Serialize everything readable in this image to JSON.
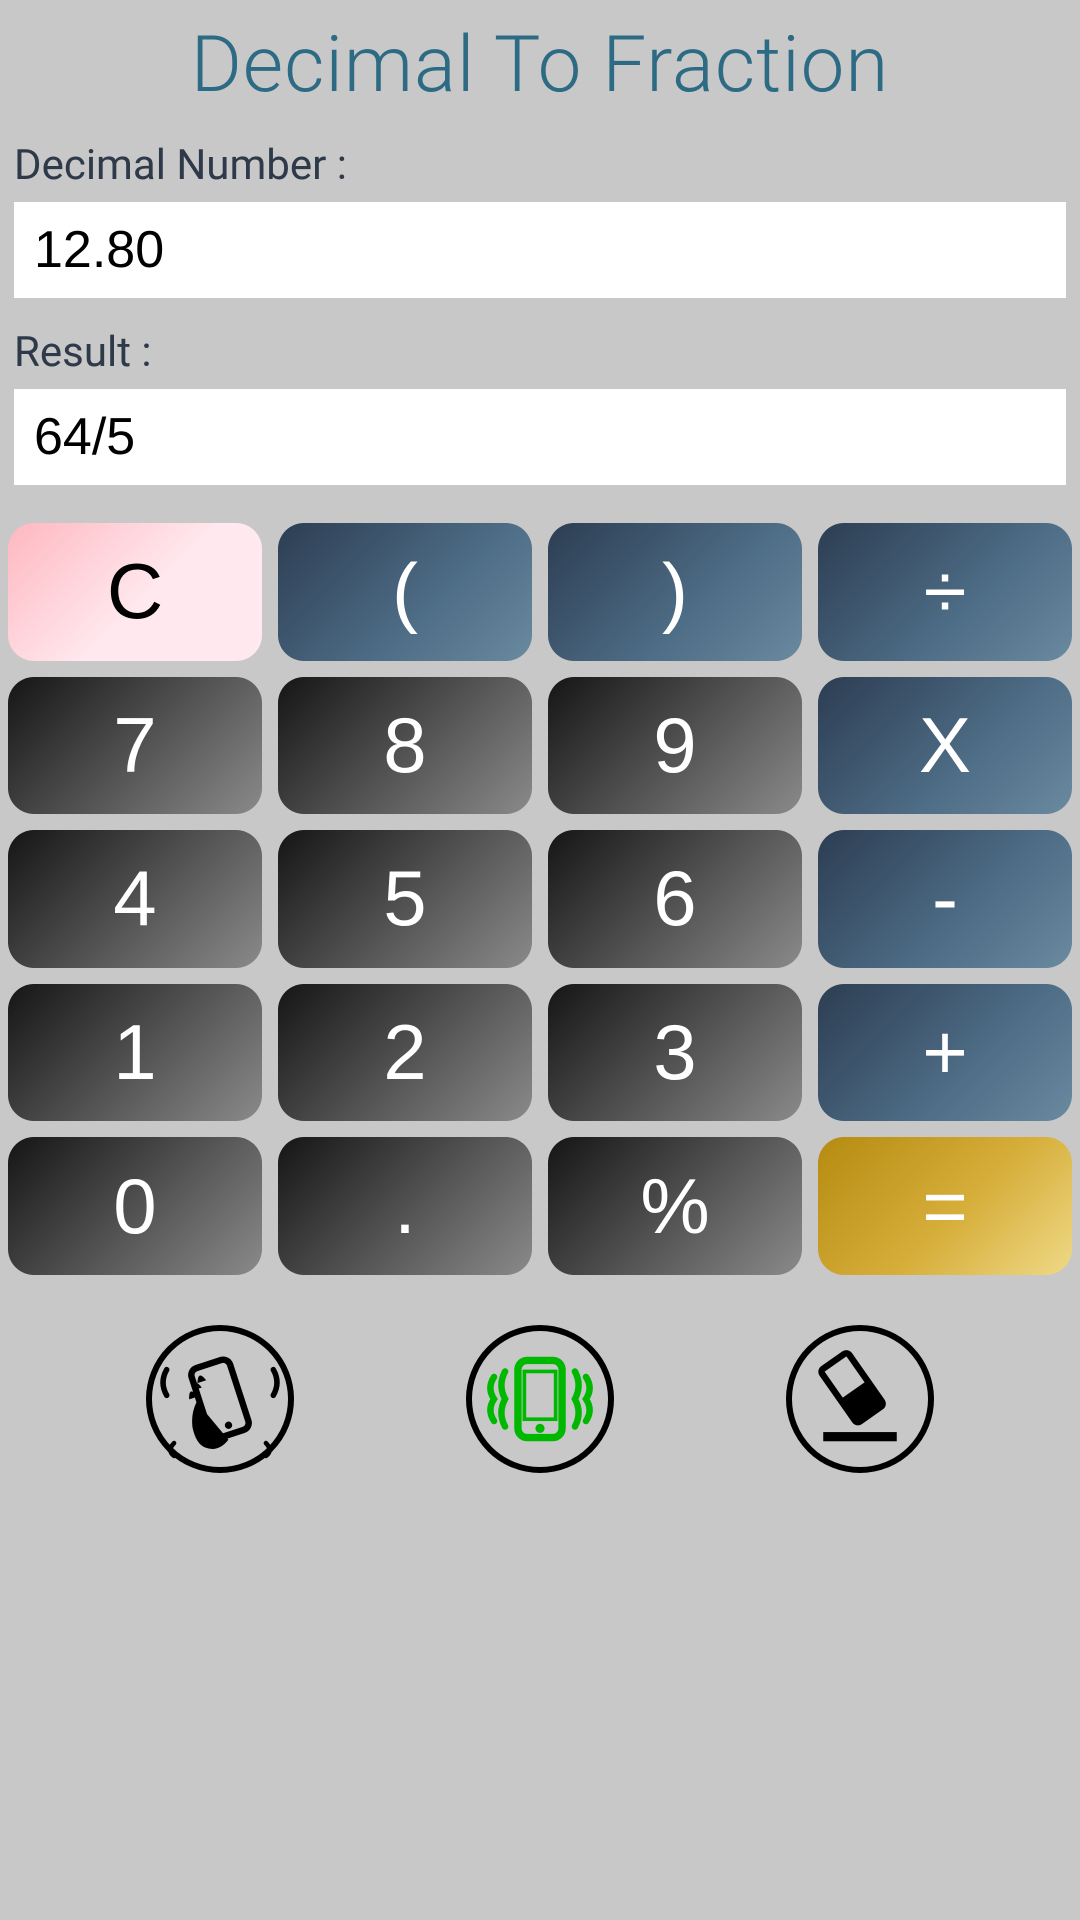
{
  "title": "Decimal To Fraction",
  "decimalLabel": "Decimal Number :",
  "decimalValue": "12.80",
  "resultLabel": "Result :",
  "resultValue": "64/5",
  "keys": {
    "clear": "C",
    "openParen": "(",
    "closeParen": ")",
    "divide": "÷",
    "seven": "7",
    "eight": "8",
    "nine": "9",
    "multiply": "X",
    "four": "4",
    "five": "5",
    "six": "6",
    "minus": "-",
    "one": "1",
    "two": "2",
    "three": "3",
    "plus": "+",
    "zero": "0",
    "dot": ".",
    "percent": "%",
    "equals": "="
  }
}
